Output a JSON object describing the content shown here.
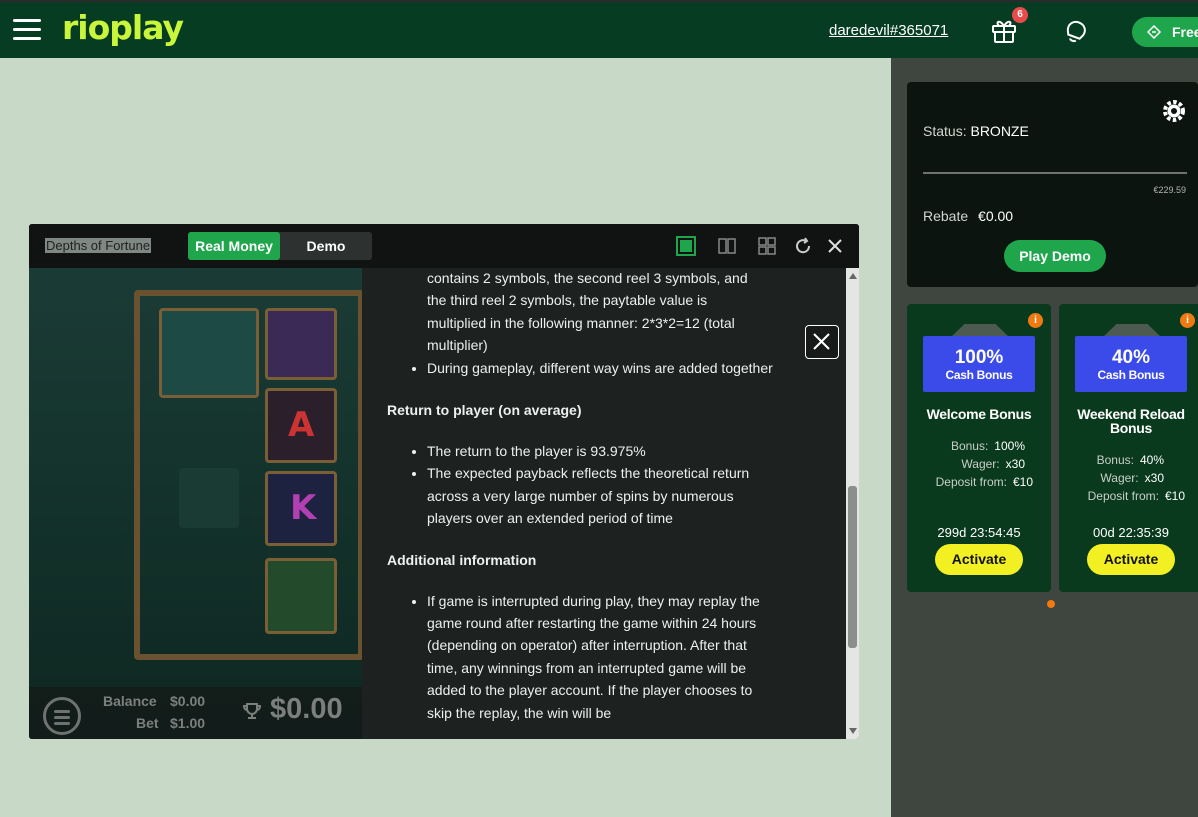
{
  "header": {
    "logo": "rioplay",
    "username": "daredevil#365071",
    "gift_count": "6",
    "free_label": "Free"
  },
  "status": {
    "label": "Status:",
    "level": "BRONZE",
    "progress_amount": "€229.59",
    "rebate_label": "Rebate",
    "rebate_value": "€0.00",
    "play_demo": "Play Demo"
  },
  "bonuses": [
    {
      "badge_pct": "100%",
      "badge_sub": "Cash Bonus",
      "title": "Welcome Bonus",
      "bonus_label": "Bonus:",
      "bonus_value": "100%",
      "wager_label": "Wager:",
      "wager_value": "x30",
      "deposit_label": "Deposit from:",
      "deposit_value": "€10",
      "timer": "299d  23:54:45",
      "activate": "Activate"
    },
    {
      "badge_pct": "40%",
      "badge_sub": "Cash Bonus",
      "title": "Weekend Reload Bonus",
      "bonus_label": "Bonus:",
      "bonus_value": "40%",
      "wager_label": "Wager:",
      "wager_value": "x30",
      "deposit_label": "Deposit from:",
      "deposit_value": "€10",
      "timer": "00d  22:35:39",
      "activate": "Activate"
    }
  ],
  "game": {
    "title": "Depths of Fortune",
    "mode_real": "Real Money",
    "mode_demo": "Demo",
    "balance_label": "Balance",
    "balance_value": "$0.00",
    "bet_label": "Bet",
    "bet_value": "$1.00",
    "win_value": "$0.00",
    "symbol_a": "A",
    "symbol_k": "K"
  },
  "paytable": {
    "intro_lines": [
      "contains 2 symbols, the second reel 3 symbols, and",
      "the third reel 2 symbols, the paytable value is",
      "multiplied in the following manner: 2*3*2=12 (total",
      "multiplier)"
    ],
    "bullet_ways": "During gameplay, different way wins are added together",
    "rtp_heading": "Return to player (on average)",
    "rtp_bullet1": "The return to the player is 93.975%",
    "rtp_bullet2": "The expected payback reflects the theoretical return across a very large number of spins by numerous players over an extended period of time",
    "info_heading": "Additional information",
    "info_bullet1": "If game is interrupted during play, they may replay the game round after restarting the game within 24 hours (depending on operator) after interruption. After that time, any winnings from an interrupted game will be added to the player account. If the player chooses to skip the replay, the win will be"
  },
  "colors": {
    "brand_green": "#1fa64c",
    "header_bg": "#063d22",
    "logo_lime": "#c9f53b",
    "activate_yellow": "#f2ef22",
    "badge_blue": "#3b4bea",
    "accent_orange": "#f07a12"
  }
}
